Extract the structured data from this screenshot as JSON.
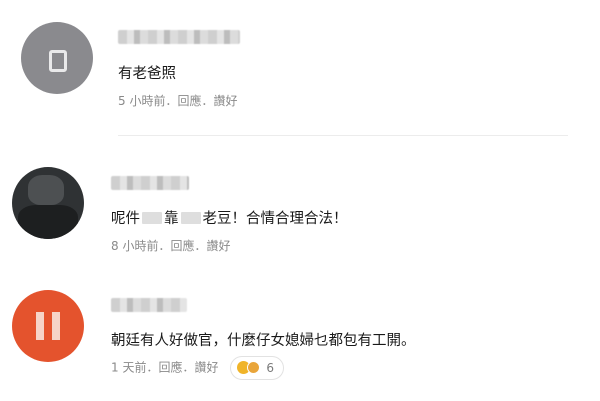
{
  "comments": [
    {
      "avatar": "default-user-icon",
      "name": "",
      "text": "有老爸照",
      "meta": {
        "time": "5 小時前",
        "reply": "回應",
        "like": "讚好"
      }
    },
    {
      "avatar": "photo",
      "name": "",
      "text_parts": [
        "呢件",
        "靠",
        "老豆！合情合理合法！"
      ],
      "meta": {
        "time": "8 小時前",
        "reply": "回應",
        "like": "讚好"
      }
    },
    {
      "avatar": "initial",
      "name": "",
      "text": "朝廷有人好做官，什麼仔女媳婦乜都包有工開。",
      "meta": {
        "time": "1 天前",
        "reply": "回應",
        "like": "讚好",
        "reaction_count": "6",
        "reaction_icons": [
          "like-emoji-icon",
          "haha-emoji-icon"
        ]
      }
    }
  ],
  "colors": {
    "meta": "#8a8a8a",
    "text": "#1a1a1a",
    "avatar_orange": "#e4532d"
  }
}
